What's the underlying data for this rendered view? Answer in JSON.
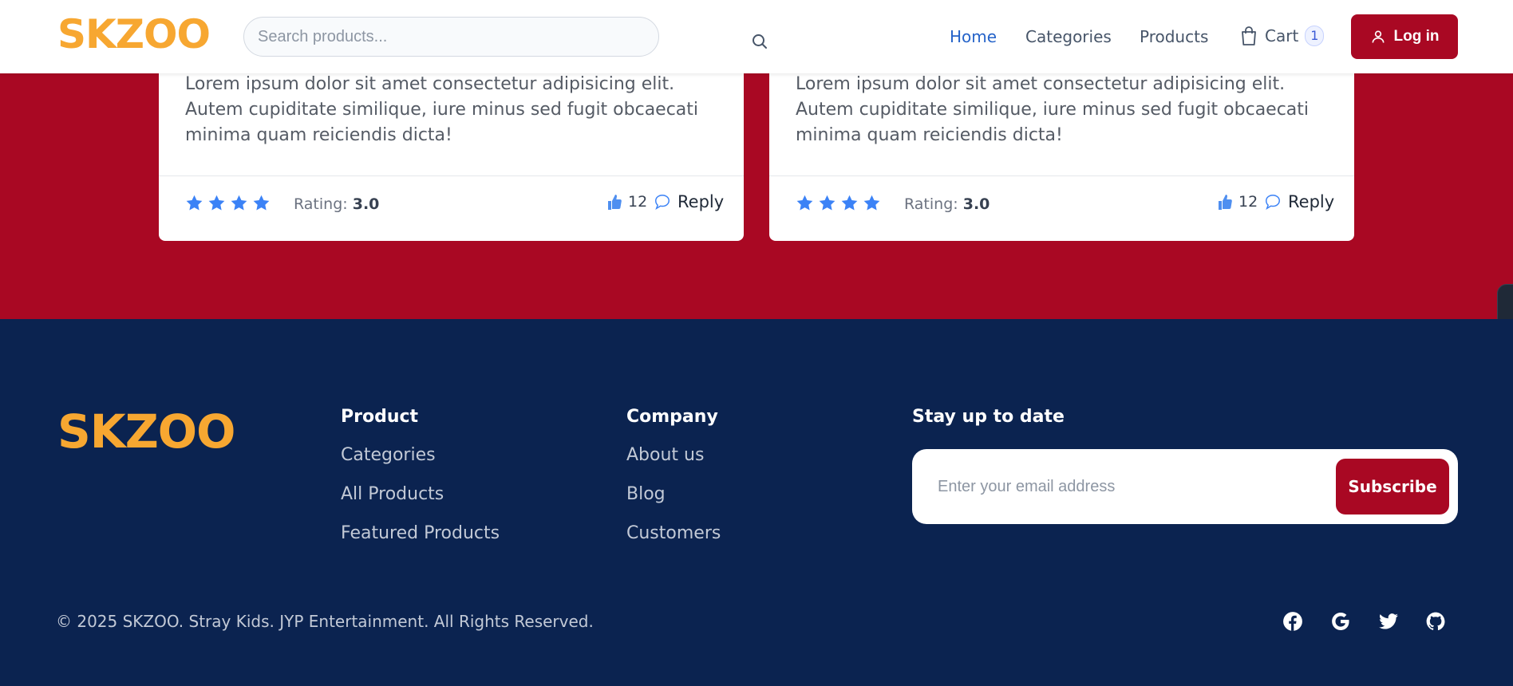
{
  "header": {
    "logo": "SKZOO",
    "search_placeholder": "Search products...",
    "nav": [
      "Home",
      "Categories",
      "Products"
    ],
    "cart_label": "Cart",
    "cart_count": "1",
    "login_label": "Log in"
  },
  "reviews": [
    {
      "text": "Lorem ipsum dolor sit amet consectetur adipisicing elit. Autem cupiditate similique, iure minus sed fugit obcaecati minima quam reiciendis dicta!",
      "stars": 4,
      "rating_label": "Rating:",
      "rating_value": "3.0",
      "likes": "12",
      "reply_label": "Reply"
    },
    {
      "text": "Lorem ipsum dolor sit amet consectetur adipisicing elit. Autem cupiditate similique, iure minus sed fugit obcaecati minima quam reiciendis dicta!",
      "stars": 4,
      "rating_label": "Rating:",
      "rating_value": "3.0",
      "likes": "12",
      "reply_label": "Reply"
    }
  ],
  "footer": {
    "logo": "SKZOO",
    "product_title": "Product",
    "product_links": [
      "Categories",
      "All Products",
      "Featured Products"
    ],
    "company_title": "Company",
    "company_links": [
      "About us",
      "Blog",
      "Customers"
    ],
    "newsletter_title": "Stay up to date",
    "email_placeholder": "Enter your email address",
    "subscribe_label": "Subscribe",
    "copyright": "© 2025 SKZOO. Stray Kids. JYP Entertainment. All Rights Reserved.",
    "social": [
      "facebook-icon",
      "google-icon",
      "twitter-icon",
      "github-icon"
    ]
  },
  "colors": {
    "brand_red": "#a90823",
    "brand_navy": "#0b2350",
    "logo_orange": "#f7a731",
    "star_blue": "#3b82f6",
    "active_nav": "#2563c9"
  }
}
